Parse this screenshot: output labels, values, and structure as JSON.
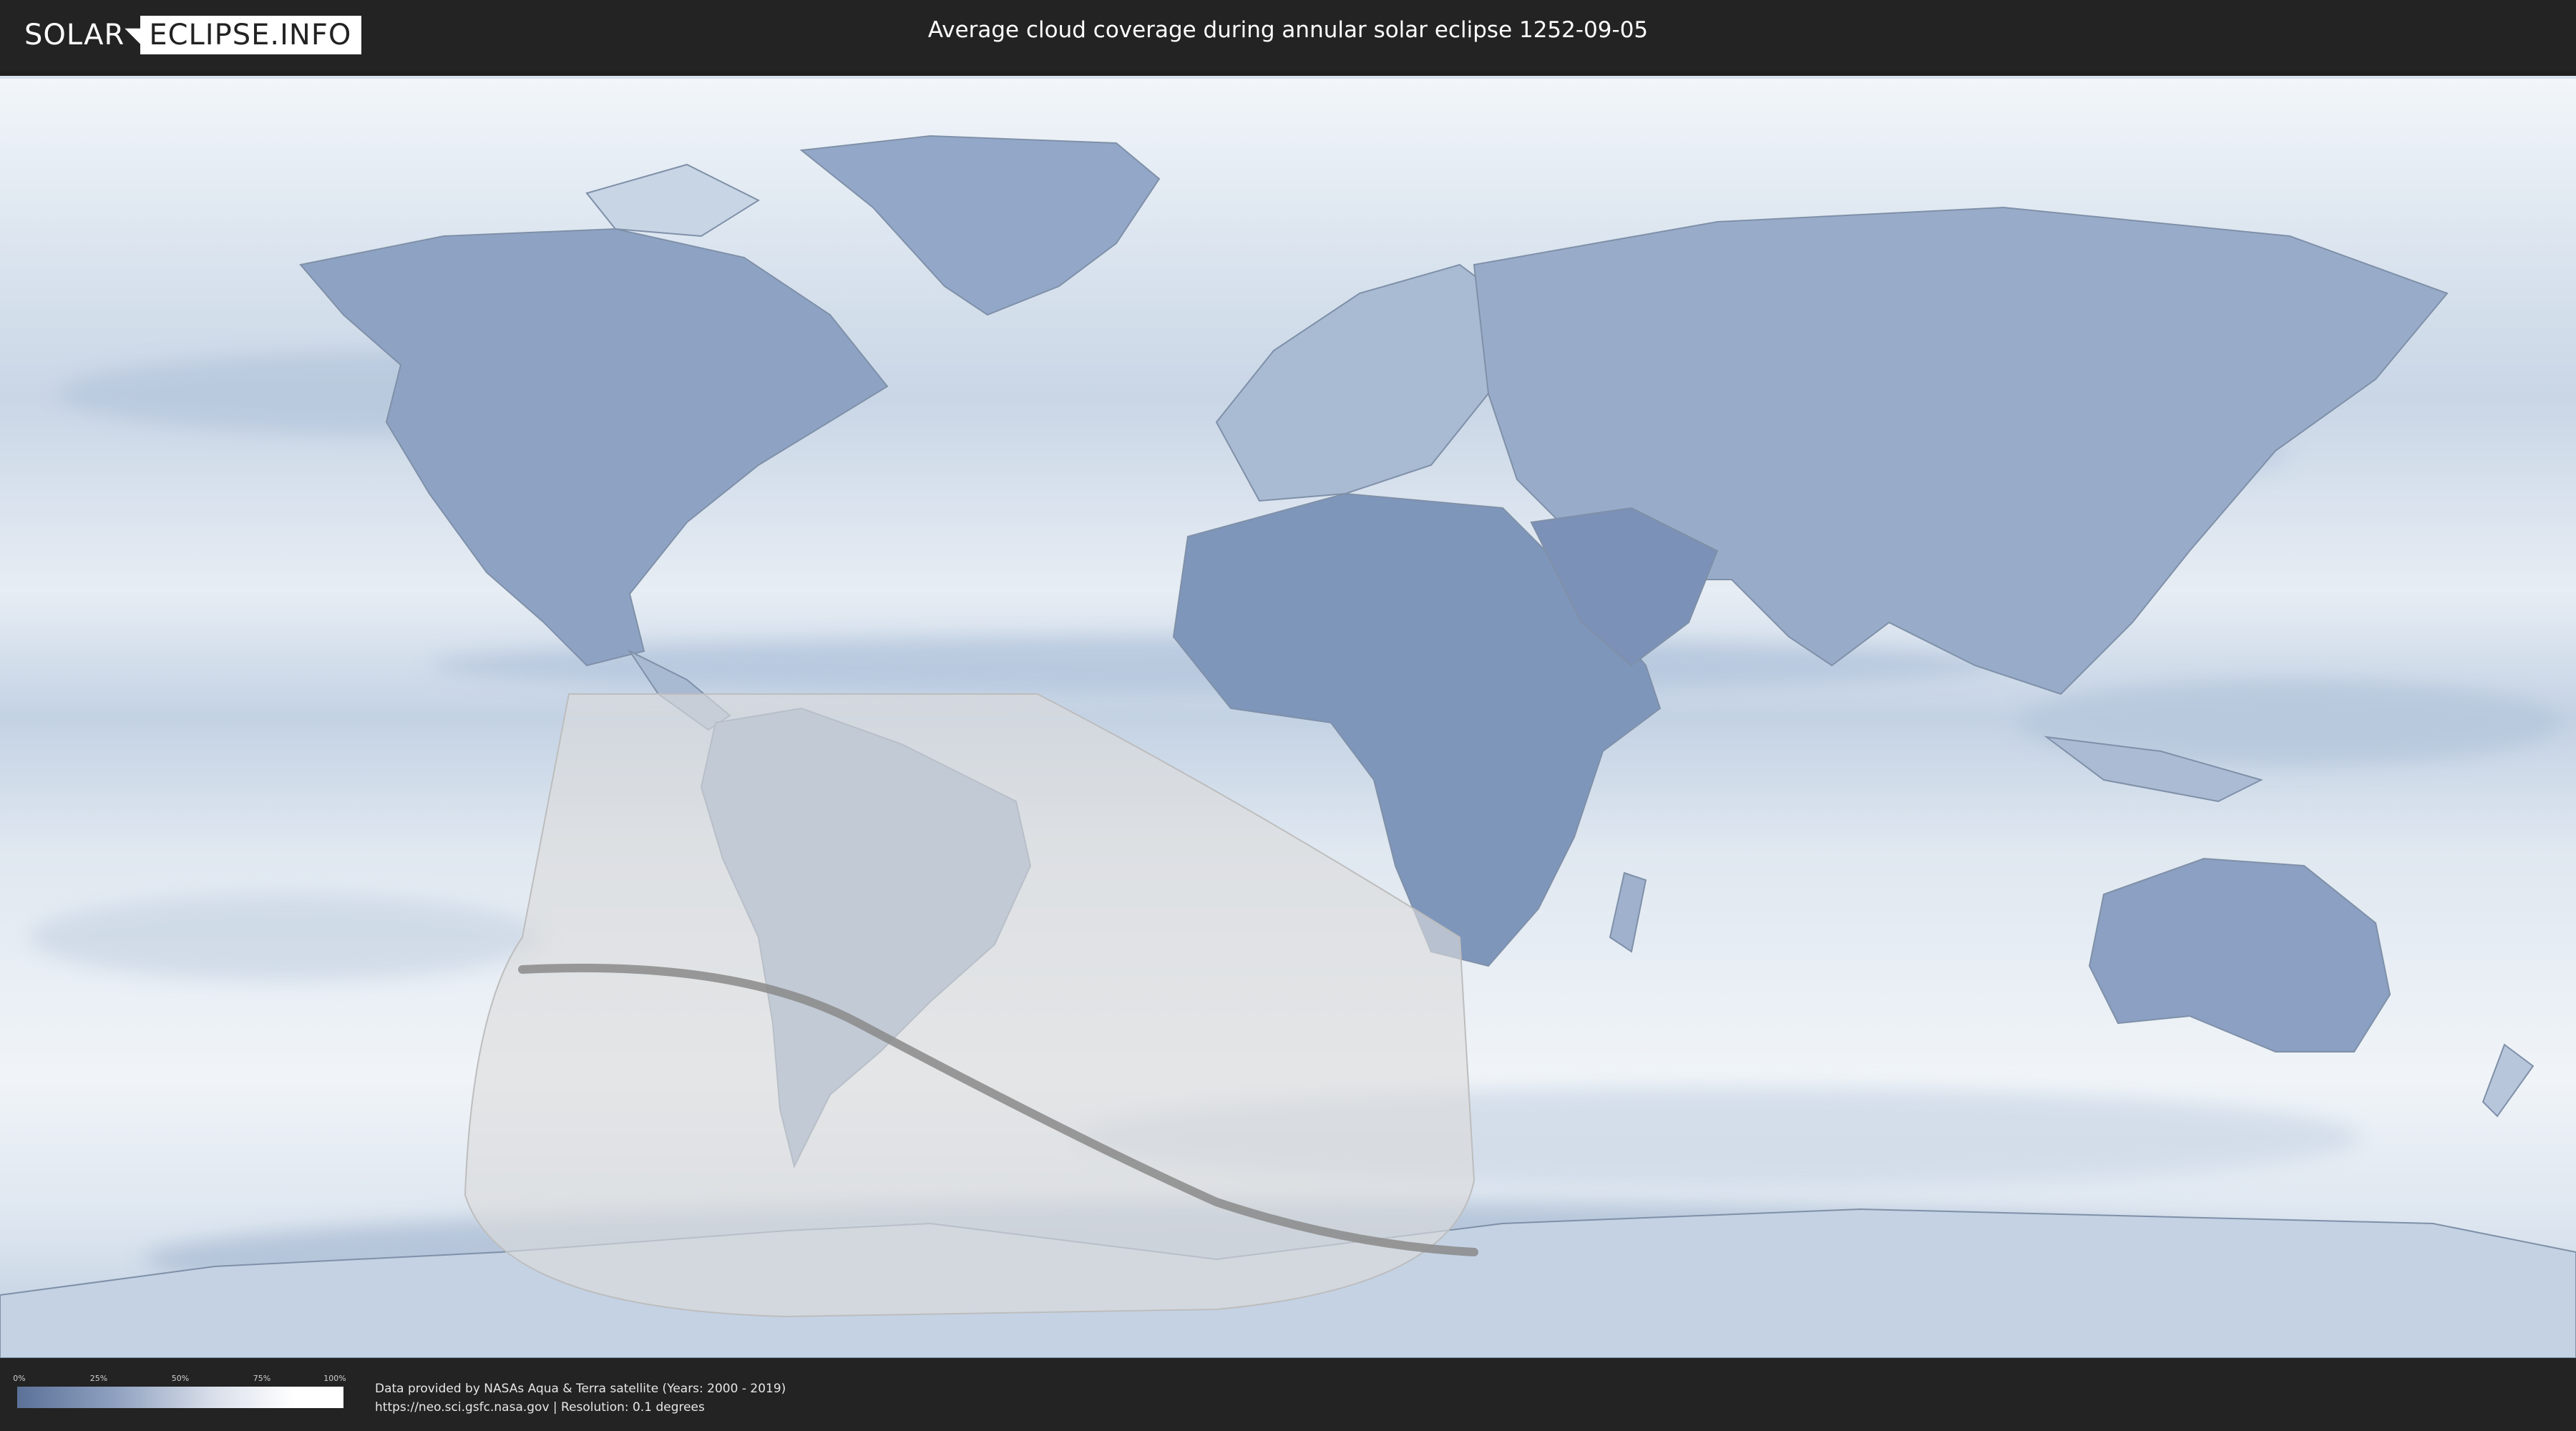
{
  "header": {
    "logo_left": "SOLAR",
    "logo_right": "ECLIPSE.INFO",
    "title": "Average cloud coverage during annular solar eclipse 1252-09-05"
  },
  "map": {
    "type": "world-cloud-coverage",
    "eclipse_zone_color": "#dcdcdc",
    "central_line_color": "#8a8a8a",
    "ocean_base": "#e9eef5",
    "cloud_low": "#5b7198",
    "cloud_high": "#ffffff"
  },
  "legend": {
    "ticks": [
      "0%",
      "25%",
      "50%",
      "75%",
      "100%"
    ],
    "colors": [
      "#5b7198",
      "#ffffff"
    ]
  },
  "footer": {
    "credit_line1": "Data provided by NASAs Aqua & Terra satellite (Years: 2000 - 2019)",
    "credit_line2": "https://neo.sci.gsfc.nasa.gov | Resolution: 0.1 degrees"
  }
}
